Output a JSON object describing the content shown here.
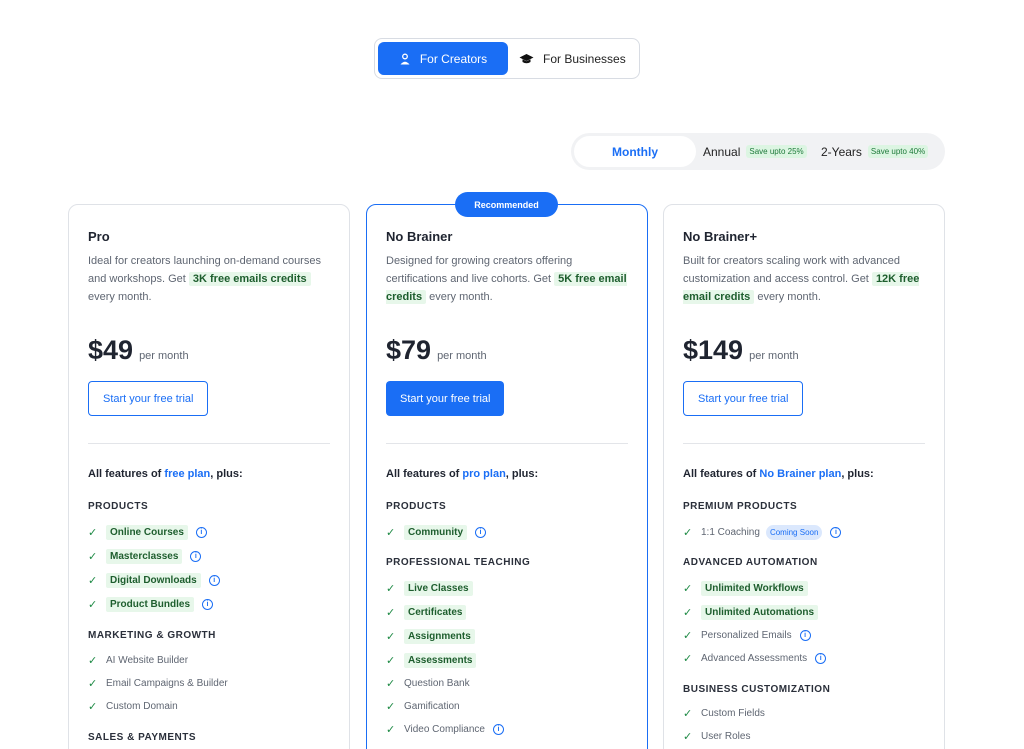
{
  "audience": {
    "creators": "For Creators",
    "businesses": "For Businesses"
  },
  "billing": {
    "monthly": "Monthly",
    "annual": "Annual",
    "annual_save": "Save upto 25%",
    "two_years": "2-Years",
    "two_years_save": "Save upto 40%"
  },
  "common": {
    "per_month": "per month",
    "cta": "Start your free trial",
    "all_features_prefix": "All features of ",
    "all_features_suffix": ", plus:"
  },
  "plans": [
    {
      "name": "Pro",
      "desc_pre": "Ideal for creators launching on-demand courses and workshops. Get ",
      "desc_hl": "3K free emails credits",
      "desc_post": " every month.",
      "price": "$49",
      "base_plan": "free plan",
      "sections": [
        {
          "title": "PRODUCTS",
          "items": [
            "Online Courses",
            "Masterclasses",
            "Digital Downloads",
            "Product Bundles"
          ]
        },
        {
          "title": "MARKETING & GROWTH",
          "items": [
            "AI Website Builder",
            "Email Campaigns & Builder",
            "Custom Domain"
          ]
        },
        {
          "title": "SALES & PAYMENTS",
          "items": []
        }
      ]
    },
    {
      "name": "No Brainer",
      "badge": "Recommended",
      "desc_pre": "Designed for growing creators offering certifications and live cohorts. Get ",
      "desc_hl": "5K free email credits",
      "desc_post": " every month.",
      "price": "$79",
      "base_plan": "pro plan",
      "sections": [
        {
          "title": "PRODUCTS",
          "items": [
            "Community"
          ]
        },
        {
          "title": "PROFESSIONAL TEACHING",
          "items": [
            "Live Classes",
            "Certificates",
            "Assignments",
            "Assessments",
            "Question Bank",
            "Gamification",
            "Video Compliance"
          ]
        }
      ]
    },
    {
      "name": "No Brainer+",
      "desc_pre": "Built for creators scaling work with advanced customization and access control. Get ",
      "desc_hl": "12K free email credits",
      "desc_post": " every month.",
      "price": "$149",
      "base_plan": "No Brainer plan",
      "sections": [
        {
          "title": "PREMIUM PRODUCTS",
          "items": [
            "1:1 Coaching"
          ],
          "coming_soon": "Coming Soon"
        },
        {
          "title": "ADVANCED AUTOMATION",
          "items": [
            "Unlimited Workflows",
            "Unlimited Automations",
            "Personalized Emails",
            "Advanced Assessments"
          ]
        },
        {
          "title": "BUSINESS CUSTOMIZATION",
          "items": [
            "Custom Fields",
            "User Roles"
          ]
        }
      ]
    }
  ],
  "colors": {
    "accent": "#1a6ef5",
    "check": "#1e8a45",
    "highlight_bg": "#e7f7ea"
  }
}
